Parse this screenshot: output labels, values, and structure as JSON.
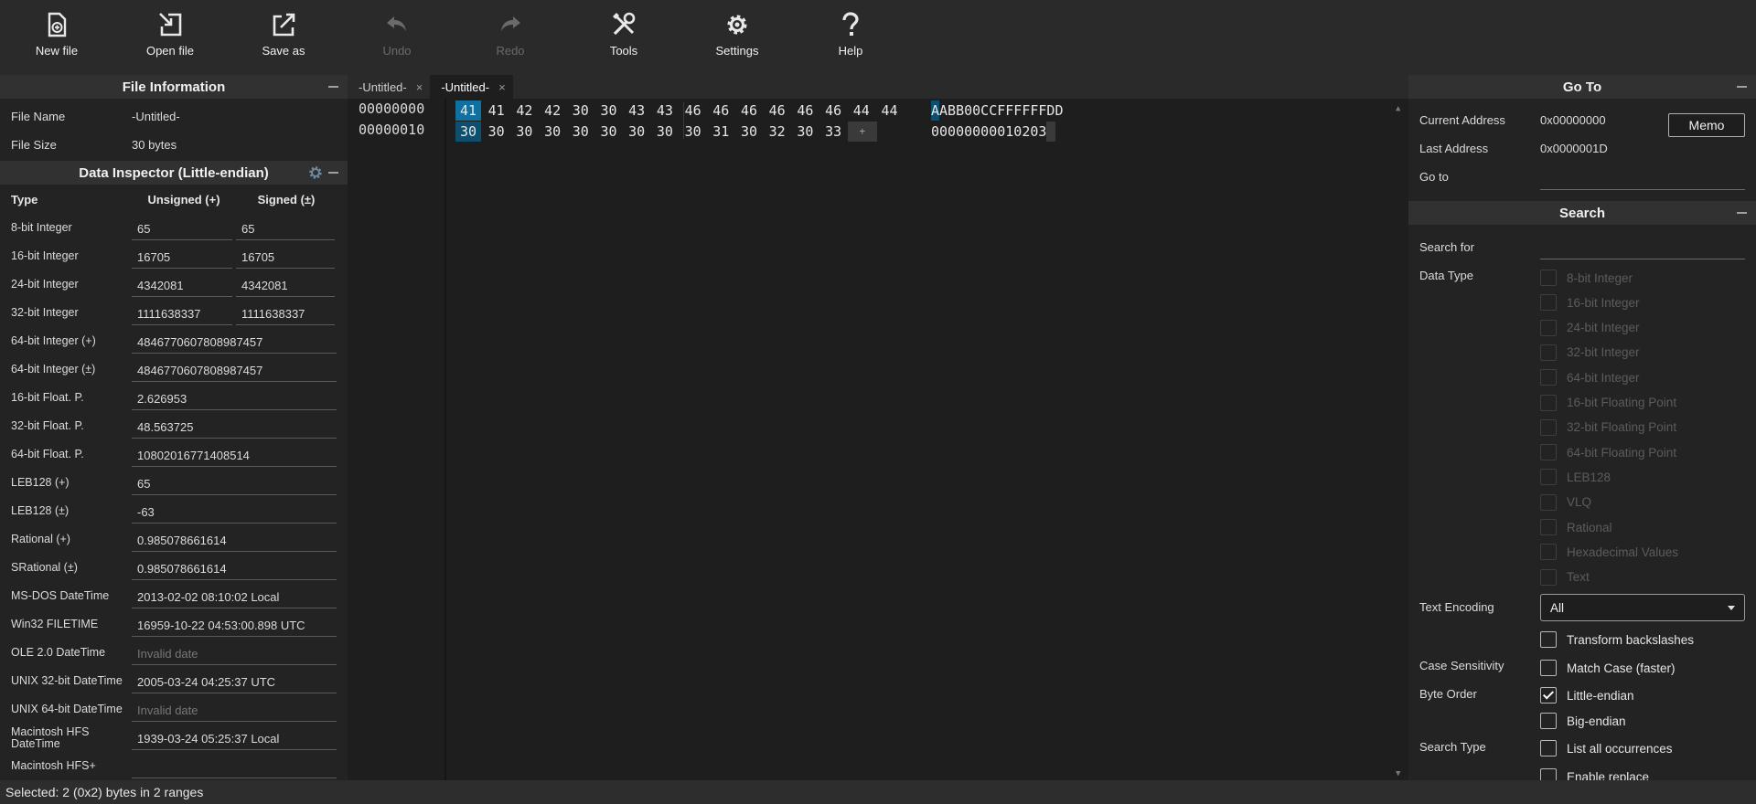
{
  "toolbar": {
    "new_file": "New file",
    "open_file": "Open file",
    "save_as": "Save as",
    "undo": "Undo",
    "redo": "Redo",
    "tools": "Tools",
    "settings": "Settings",
    "help": "Help"
  },
  "file_info": {
    "title": "File Information",
    "name_label": "File Name",
    "name_value": "-Untitled-",
    "size_label": "File Size",
    "size_value": "30 bytes"
  },
  "inspector": {
    "title": "Data Inspector (Little-endian)",
    "col_type": "Type",
    "col_unsigned": "Unsigned (+)",
    "col_signed": "Signed (±)",
    "rows": [
      {
        "type": "8-bit Integer",
        "u": "65",
        "s": "65"
      },
      {
        "type": "16-bit Integer",
        "u": "16705",
        "s": "16705"
      },
      {
        "type": "24-bit Integer",
        "u": "4342081",
        "s": "4342081"
      },
      {
        "type": "32-bit Integer",
        "u": "1111638337",
        "s": "1111638337"
      },
      {
        "type": "64-bit Integer (+)",
        "v": "4846770607808987457"
      },
      {
        "type": "64-bit Integer (±)",
        "v": "4846770607808987457"
      },
      {
        "type": "16-bit Float. P.",
        "v": "2.626953"
      },
      {
        "type": "32-bit Float. P.",
        "v": "48.563725"
      },
      {
        "type": "64-bit Float. P.",
        "v": "10802016771408514"
      },
      {
        "type": "LEB128 (+)",
        "v": "65"
      },
      {
        "type": "LEB128 (±)",
        "v": "-63"
      },
      {
        "type": "Rational (+)",
        "v": "0.985078661614"
      },
      {
        "type": "SRational (±)",
        "v": "0.985078661614"
      },
      {
        "type": "MS-DOS DateTime",
        "v": "2013-02-02 08:10:02 Local"
      },
      {
        "type": "Win32 FILETIME",
        "v": "16959-10-22 04:53:00.898 UTC"
      },
      {
        "type": "OLE 2.0 DateTime",
        "v": "Invalid date"
      },
      {
        "type": "UNIX 32-bit DateTime",
        "v": "2005-03-24 04:25:37 UTC"
      },
      {
        "type": "UNIX 64-bit DateTime",
        "v": "Invalid date"
      },
      {
        "type": "Macintosh HFS DateTime",
        "v": "1939-03-24 05:25:37 Local"
      },
      {
        "type": "Macintosh HFS+",
        "v": ""
      }
    ]
  },
  "tabs": [
    {
      "label": "-Untitled-",
      "close": "×"
    },
    {
      "label": "-Untitled-",
      "close": "×"
    }
  ],
  "hex": {
    "rows": [
      {
        "address": "00000000",
        "bytes": [
          "41",
          "41",
          "42",
          "42",
          "30",
          "30",
          "43",
          "43",
          "46",
          "46",
          "46",
          "46",
          "46",
          "46",
          "44",
          "44"
        ],
        "ascii_first": "A",
        "ascii_rest": "ABB00CCFFFFFFDD"
      },
      {
        "address": "00000010",
        "bytes": [
          "30",
          "30",
          "30",
          "30",
          "30",
          "30",
          "30",
          "30",
          "30",
          "31",
          "30",
          "32",
          "30",
          "33"
        ],
        "ascii_first": "",
        "ascii_rest": "00000000010203"
      }
    ],
    "append": "+"
  },
  "goto": {
    "title": "Go To",
    "current_label": "Current Address",
    "current_value": "0x00000000",
    "last_label": "Last Address",
    "last_value": "0x0000001D",
    "goto_label": "Go to",
    "memo": "Memo"
  },
  "search": {
    "title": "Search",
    "search_for": "Search for",
    "data_type": "Data Type",
    "types": [
      "8-bit Integer",
      "16-bit Integer",
      "24-bit Integer",
      "32-bit Integer",
      "64-bit Integer",
      "16-bit Floating Point",
      "32-bit Floating Point",
      "64-bit Floating Point",
      "LEB128",
      "VLQ",
      "Rational",
      "Hexadecimal Values",
      "Text"
    ],
    "text_encoding_label": "Text Encoding",
    "text_encoding_value": "All",
    "transform_backslashes": "Transform backslashes",
    "case_label": "Case Sensitivity",
    "match_case": "Match Case (faster)",
    "byte_order_label": "Byte Order",
    "little_endian": "Little-endian",
    "big_endian": "Big-endian",
    "search_type_label": "Search Type",
    "list_all": "List all occurrences",
    "enable_replace": "Enable replace"
  },
  "status": {
    "text": "Selected: 2 (0x2) bytes in 2 ranges"
  }
}
